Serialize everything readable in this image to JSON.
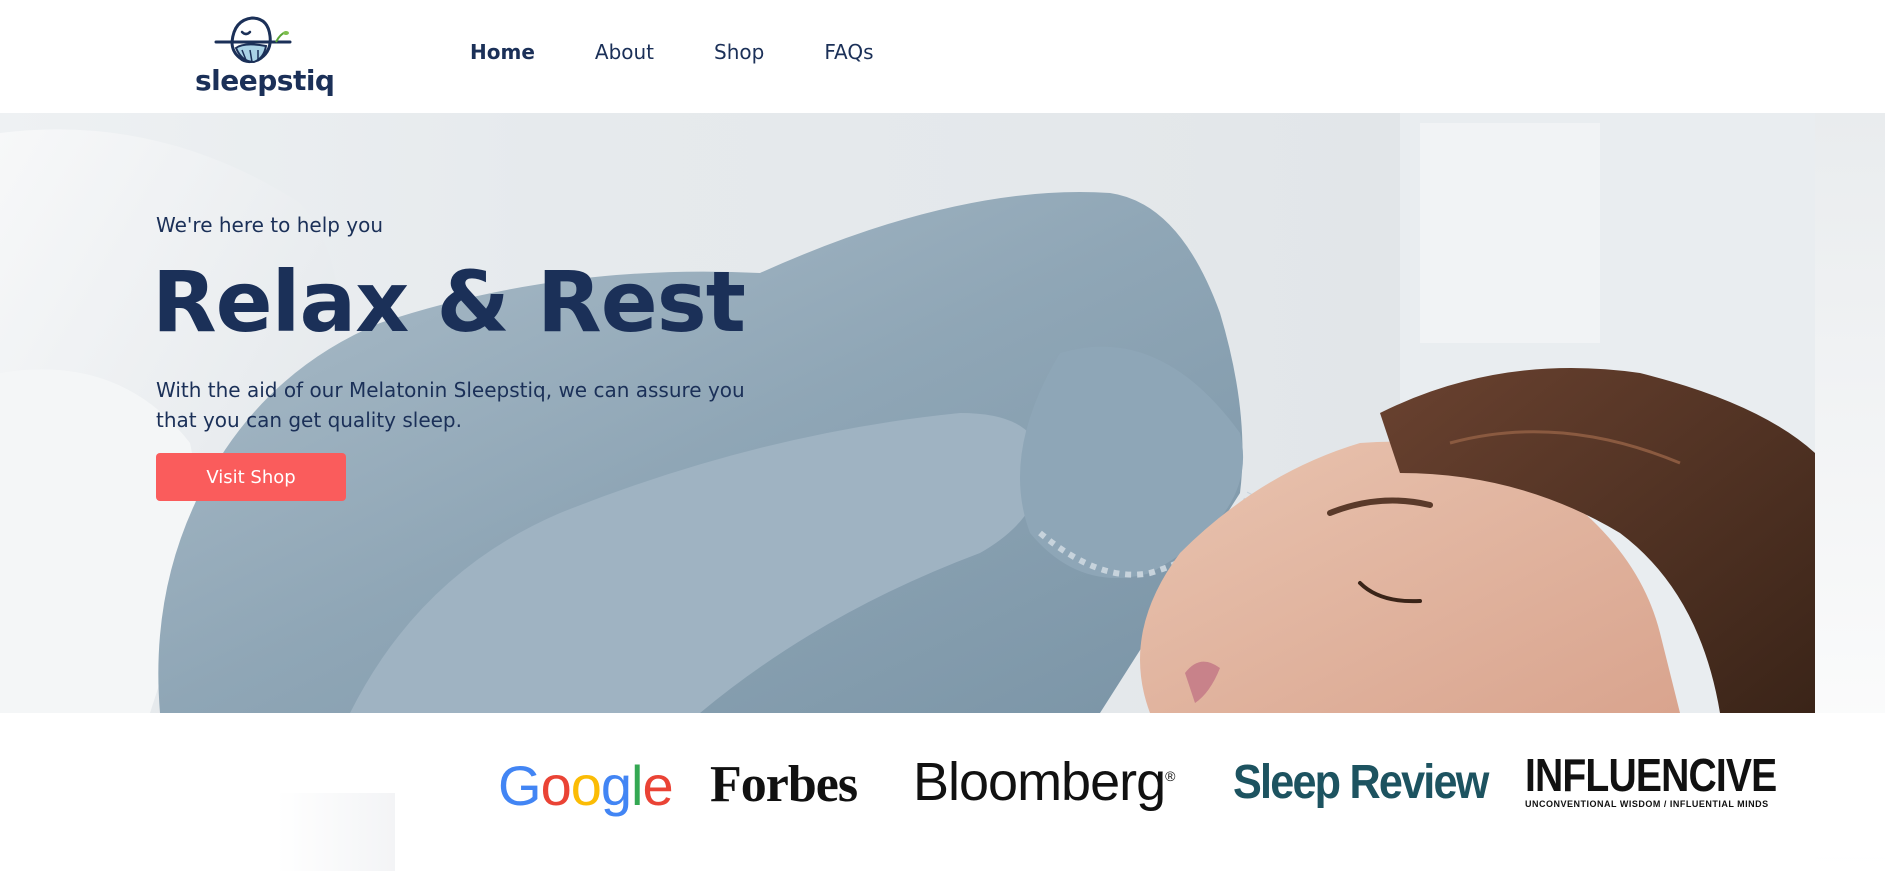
{
  "brand": {
    "name": "sleepstiq"
  },
  "nav": {
    "items": [
      {
        "label": "Home",
        "active": true
      },
      {
        "label": "About",
        "active": false
      },
      {
        "label": "Shop",
        "active": false
      },
      {
        "label": "FAQs",
        "active": false
      }
    ]
  },
  "hero": {
    "eyebrow": "We're here to help you",
    "title": "Relax & Rest",
    "description": "With the aid of our Melatonin Sleepstiq, we can assure you that you can get quality sleep.",
    "cta_label": "Visit Shop"
  },
  "press": {
    "logos": [
      {
        "name": "Google",
        "text": "Google"
      },
      {
        "name": "Forbes",
        "text": "Forbes"
      },
      {
        "name": "Bloomberg",
        "text": "Bloomberg",
        "mark": "®"
      },
      {
        "name": "Sleep Review",
        "text": "Sleep Review"
      },
      {
        "name": "Influencive",
        "text": "INFLUENCIVE",
        "tagline": "UNCONVENTIONAL WISDOM / INFLUENTIAL MINDS"
      }
    ]
  },
  "colors": {
    "navy": "#1b3058",
    "accent": "#fa5c5c",
    "white": "#ffffff",
    "google_blue": "#4285f4",
    "google_red": "#ea4335",
    "google_yellow": "#fbbc05",
    "google_green": "#34a853",
    "sleep_review_teal": "#1d5360"
  }
}
